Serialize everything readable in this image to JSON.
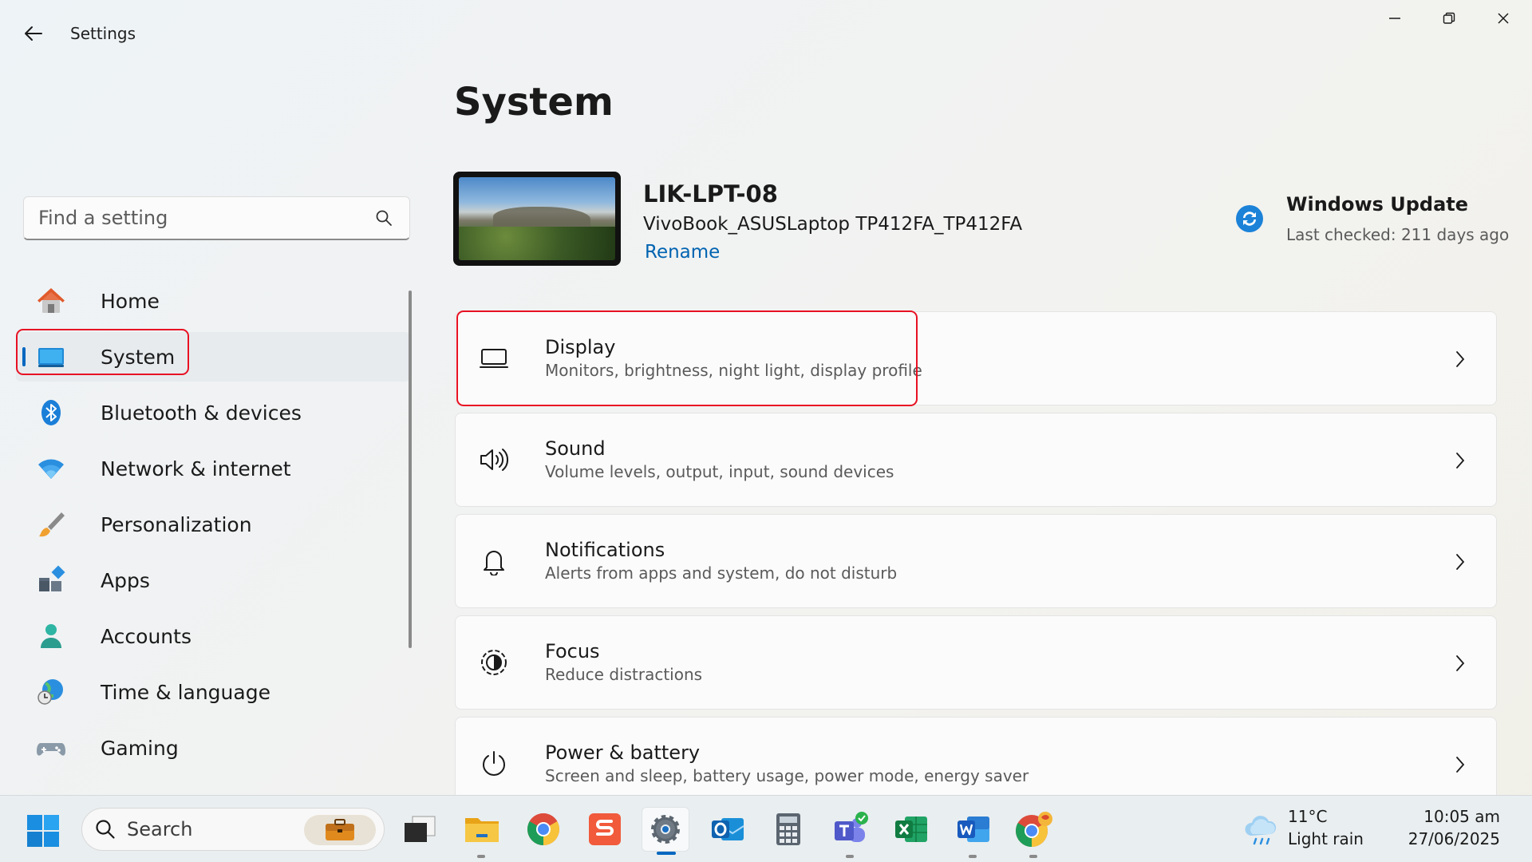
{
  "window": {
    "title": "Settings",
    "back_icon": "arrow-left-icon",
    "controls": [
      "minimize-icon",
      "restore-icon",
      "close-icon"
    ]
  },
  "search": {
    "placeholder": "Find a setting",
    "icon": "search-icon"
  },
  "sidebar": {
    "items": [
      {
        "label": "Home",
        "icon": "home-icon",
        "active": false
      },
      {
        "label": "System",
        "icon": "laptop-system-icon",
        "active": true
      },
      {
        "label": "Bluetooth & devices",
        "icon": "bluetooth-icon",
        "active": false
      },
      {
        "label": "Network & internet",
        "icon": "wifi-icon",
        "active": false
      },
      {
        "label": "Personalization",
        "icon": "brush-icon",
        "active": false
      },
      {
        "label": "Apps",
        "icon": "apps-icon",
        "active": false
      },
      {
        "label": "Accounts",
        "icon": "person-icon",
        "active": false
      },
      {
        "label": "Time & language",
        "icon": "globe-clock-icon",
        "active": false
      },
      {
        "label": "Gaming",
        "icon": "gamepad-icon",
        "active": false
      }
    ]
  },
  "main": {
    "title": "System",
    "device": {
      "name": "LIK-LPT-08",
      "model": "VivoBook_ASUSLaptop TP412FA_TP412FA",
      "rename_label": "Rename"
    },
    "windows_update": {
      "title": "Windows Update",
      "subtitle": "Last checked: 211 days ago",
      "icon": "sync-icon"
    },
    "cards": [
      {
        "title": "Display",
        "subtitle": "Monitors, brightness, night light, display profile",
        "icon": "monitor-icon"
      },
      {
        "title": "Sound",
        "subtitle": "Volume levels, output, input, sound devices",
        "icon": "speaker-icon"
      },
      {
        "title": "Notifications",
        "subtitle": "Alerts from apps and system, do not disturb",
        "icon": "bell-icon"
      },
      {
        "title": "Focus",
        "subtitle": "Reduce distractions",
        "icon": "focus-icon"
      },
      {
        "title": "Power & battery",
        "subtitle": "Screen and sleep, battery usage, power mode, energy saver",
        "icon": "power-icon"
      }
    ]
  },
  "taskbar": {
    "search_label": "Search",
    "apps": [
      "task-view-icon",
      "file-explorer-icon",
      "chrome-icon",
      "sketch-app-icon",
      "settings-icon",
      "outlook-icon",
      "calculator-icon",
      "teams-icon",
      "excel-icon",
      "word-icon",
      "chrome-profile-icon"
    ],
    "weather": {
      "temp": "11°C",
      "desc": "Light rain",
      "icon": "cloud-rain-icon"
    },
    "clock": {
      "time": "10:05 am",
      "date": "27/06/2025"
    }
  },
  "colors": {
    "accent": "#0067c0",
    "highlight": "#e81123",
    "link": "#0063b1"
  }
}
